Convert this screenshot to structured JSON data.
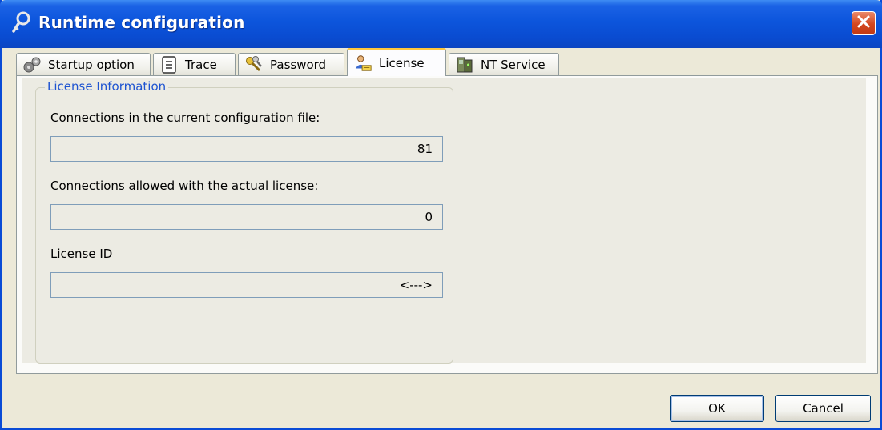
{
  "window": {
    "title": "Runtime configuration",
    "title_icon": "key-icon",
    "close_icon": "close-icon"
  },
  "tabs": [
    {
      "label": "Startup option",
      "icon": "gears-icon",
      "active": false
    },
    {
      "label": "Trace",
      "icon": "notepad-icon",
      "active": false
    },
    {
      "label": "Password",
      "icon": "keys-icon",
      "active": false
    },
    {
      "label": "License",
      "icon": "license-person-icon",
      "active": true
    },
    {
      "label": "NT Service",
      "icon": "server-icon",
      "active": false
    }
  ],
  "license_group": {
    "title": "License Information",
    "connections_config_label": "Connections in the current configuration file:",
    "connections_config_value": "81",
    "connections_allowed_label": "Connections allowed with the actual license:",
    "connections_allowed_value": "0",
    "license_id_label": "License ID",
    "license_id_value": "<--->"
  },
  "buttons": {
    "ok": "OK",
    "cancel": "Cancel"
  },
  "colors": {
    "titlebar": "#0a4bd6",
    "active_tab_highlight": "#ffc73c",
    "group_title": "#1f54d1",
    "close_button": "#d4461f"
  }
}
